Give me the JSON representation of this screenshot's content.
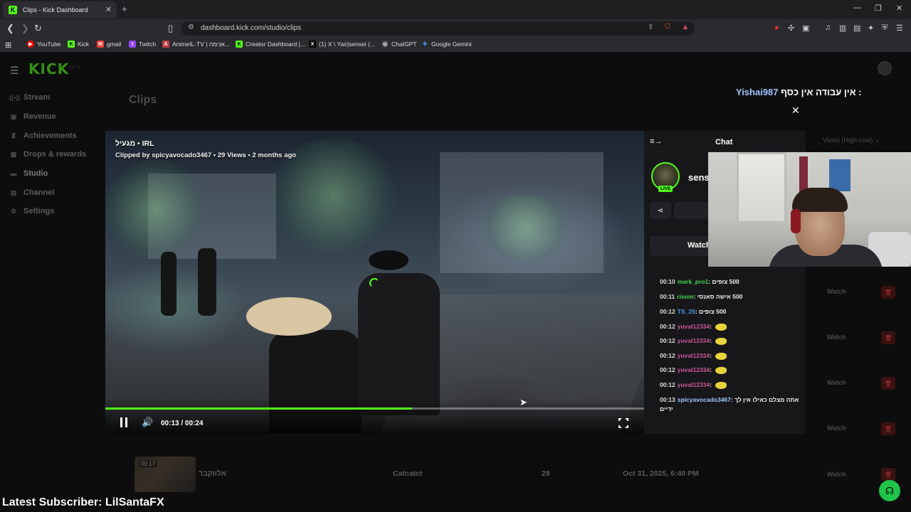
{
  "browser": {
    "tab_title": "Clips - Kick Dashboard",
    "url": "dashboard.kick.com/studio/clips",
    "bookmarks": [
      {
        "label": "YouTube",
        "color": "#ff0000"
      },
      {
        "label": "Kick",
        "color": "#53fc18"
      },
      {
        "label": "gmail",
        "color": "#ea4335"
      },
      {
        "label": "Twitch",
        "color": "#9146ff"
      },
      {
        "label": "AnimeIL-TV | אנימה...",
        "color": "#c04040"
      },
      {
        "label": "Creator Dashboard |...",
        "color": "#53fc18"
      },
      {
        "label": "(1) X \\ Yair|sensei (...",
        "color": "#000000"
      },
      {
        "label": "ChatGPT",
        "color": "#444444"
      },
      {
        "label": "Google Gemini",
        "color": "#4a8af4"
      }
    ]
  },
  "sidebar": {
    "items": [
      {
        "label": "Stream",
        "icon": "broadcast-icon"
      },
      {
        "label": "Revenue",
        "icon": "revenue-icon"
      },
      {
        "label": "Achievements",
        "icon": "trophy-icon"
      },
      {
        "label": "Drops & rewards",
        "icon": "drops-icon"
      },
      {
        "label": "Studio",
        "icon": "studio-icon"
      },
      {
        "label": "Channel",
        "icon": "channel-icon"
      },
      {
        "label": "Settings",
        "icon": "gear-icon"
      }
    ]
  },
  "page": {
    "title": "Clips",
    "sort_label": "Views (High-Low)",
    "watch_label": "Watch",
    "bottom_row": {
      "duration": "00:17",
      "title": "אלווקבר",
      "category": "Catcatct",
      "views": "28",
      "date": "Oct 31, 2025, 6:40 PM"
    }
  },
  "overlay": {
    "message": "אין עבודה אין כסף :",
    "username": "Yishai987"
  },
  "video": {
    "title_line": "מגעיל • IRL",
    "meta_line": "Clipped by spicyavocado3467 • 29 Views • 2 months ago",
    "time": "00:13 / 00:24",
    "progress": 0.57
  },
  "chat": {
    "title": "Chat",
    "channel_name": "sens",
    "live_label": "LIVE",
    "watch_label": "Watch",
    "messages": [
      {
        "ts": "00:10",
        "user": "mark_pro1",
        "color": "#3fd64a",
        "text": "500 צופים",
        "emote": false
      },
      {
        "ts": "00:11",
        "user": "risom",
        "color": "#3fd64a",
        "text": "500 אישה סאנסי",
        "emote": false
      },
      {
        "ts": "00:12",
        "user": "TS_25",
        "color": "#4a9af4",
        "text": "500 צופים",
        "emote": false
      },
      {
        "ts": "00:12",
        "user": "yuval12334",
        "color": "#d0579a",
        "text": "",
        "emote": true
      },
      {
        "ts": "00:12",
        "user": "yuval12334",
        "color": "#d0579a",
        "text": "",
        "emote": true
      },
      {
        "ts": "00:12",
        "user": "yuval12334",
        "color": "#d0579a",
        "text": "",
        "emote": true
      },
      {
        "ts": "00:12",
        "user": "yuval12334",
        "color": "#d0579a",
        "text": "",
        "emote": true
      },
      {
        "ts": "00:12",
        "user": "yuval12334",
        "color": "#d0579a",
        "text": "",
        "emote": true
      },
      {
        "ts": "00:13",
        "user": "spicyavocado3467",
        "color": "#9fc5ff",
        "text": "אתה מצלם כאילו אין לך ידיים",
        "emote": false
      }
    ]
  },
  "stream_overlay": {
    "latest_subscriber": "Latest Subscriber: LilSantaFX"
  },
  "colors": {
    "accent": "#53fc18"
  }
}
